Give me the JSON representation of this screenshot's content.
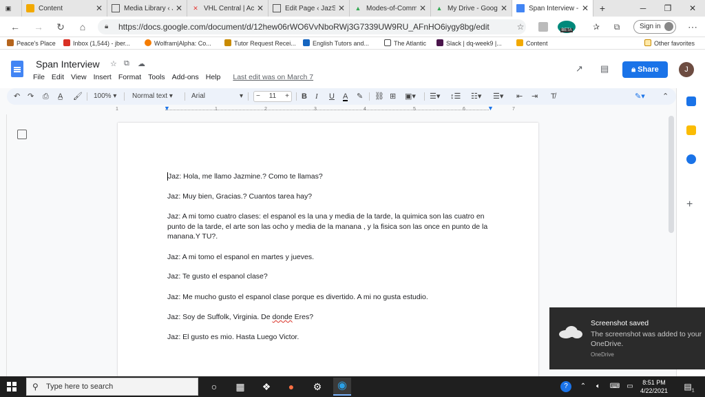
{
  "browser": {
    "tabs": [
      {
        "label": "Content",
        "icon": "moodle-icon",
        "active": false
      },
      {
        "label": "Media Library ‹ Ja",
        "icon": "doc-icon",
        "active": false
      },
      {
        "label": "VHL Central | Act",
        "icon": "vhl-icon",
        "active": false
      },
      {
        "label": "Edit Page ‹ JazSp",
        "icon": "doc-icon",
        "active": false
      },
      {
        "label": "Modes-of-Comm",
        "icon": "drive-icon",
        "active": false
      },
      {
        "label": "My Drive - Googl",
        "icon": "drive-icon",
        "active": false
      },
      {
        "label": "Span Interview - ",
        "icon": "gdocs-icon",
        "active": true
      }
    ],
    "new_tab": "+",
    "url": "https://docs.google.com/document/d/12hew06rWO6VvNboRWj3G7339UW9RU_AFnHO6iygy8bg/edit",
    "badge": "BETA",
    "signin_label": "Sign in",
    "bookmarks": [
      {
        "label": "Peace's Place",
        "color": "#b5651d"
      },
      {
        "label": "Inbox (1,544) - jber...",
        "color": "#d93025"
      },
      {
        "label": "Wolfram|Alpha: Co...",
        "color": "#f57c00"
      },
      {
        "label": "Tutor Request Recei...",
        "color": "#c98b00"
      },
      {
        "label": "English Tutors and...",
        "color": "#1565c0"
      },
      {
        "label": "The Atlantic",
        "color": "#444444"
      },
      {
        "label": "Slack | dq-week9 |...",
        "color": "#4a154b"
      },
      {
        "label": "Content",
        "color": "#f2a900"
      }
    ],
    "other_favorites": "Other favorites"
  },
  "docs": {
    "title": "Span Interview",
    "menu": [
      "File",
      "Edit",
      "View",
      "Insert",
      "Format",
      "Tools",
      "Add-ons",
      "Help"
    ],
    "last_edit": "Last edit was on March 7",
    "share_label": "Share",
    "avatar_initial": "J",
    "toolbar": {
      "zoom": "100%",
      "style": "Normal text",
      "font": "Arial",
      "font_size": "11"
    },
    "ruler_numbers": [
      "1",
      "1",
      "2",
      "3",
      "4",
      "5",
      "6",
      "7"
    ]
  },
  "document": {
    "paragraphs": [
      "Jaz: Hola, me llamo Jazmine.? Como te llamas?",
      "Jaz: Muy bien, Gracias.? Cuantos tarea hay?",
      "Jaz: A mi tomo cuatro clases: el espanol es la una y media de la tarde, la quimica  son las cuatro en punto de la tarde, el arte son las ocho y media de la manana , y la fisica  son las once en punto de la manana.Y TU?.",
      "Jaz: A mi tomo el espanol en martes y jueves.",
      "Jaz: Te gusto el espanol clase?",
      "Jaz: Me mucho gusto  el espanol clase porque es divertido.  A mi no gusta estudio.",
      "Jaz: Soy de Suffolk, Virginia. De ",
      "Jaz: El gusto es mio. Hasta Luego Victor."
    ],
    "misspelled_word": "donde",
    "after_misspelled": " Eres?"
  },
  "toast": {
    "title": "Screenshot saved",
    "body": "The screenshot was added to your OneDrive.",
    "source": "OneDrive"
  },
  "taskbar": {
    "search_placeholder": "Type here to search",
    "time": "8:51 PM",
    "date": "4/22/2021",
    "notification_count": "1"
  }
}
